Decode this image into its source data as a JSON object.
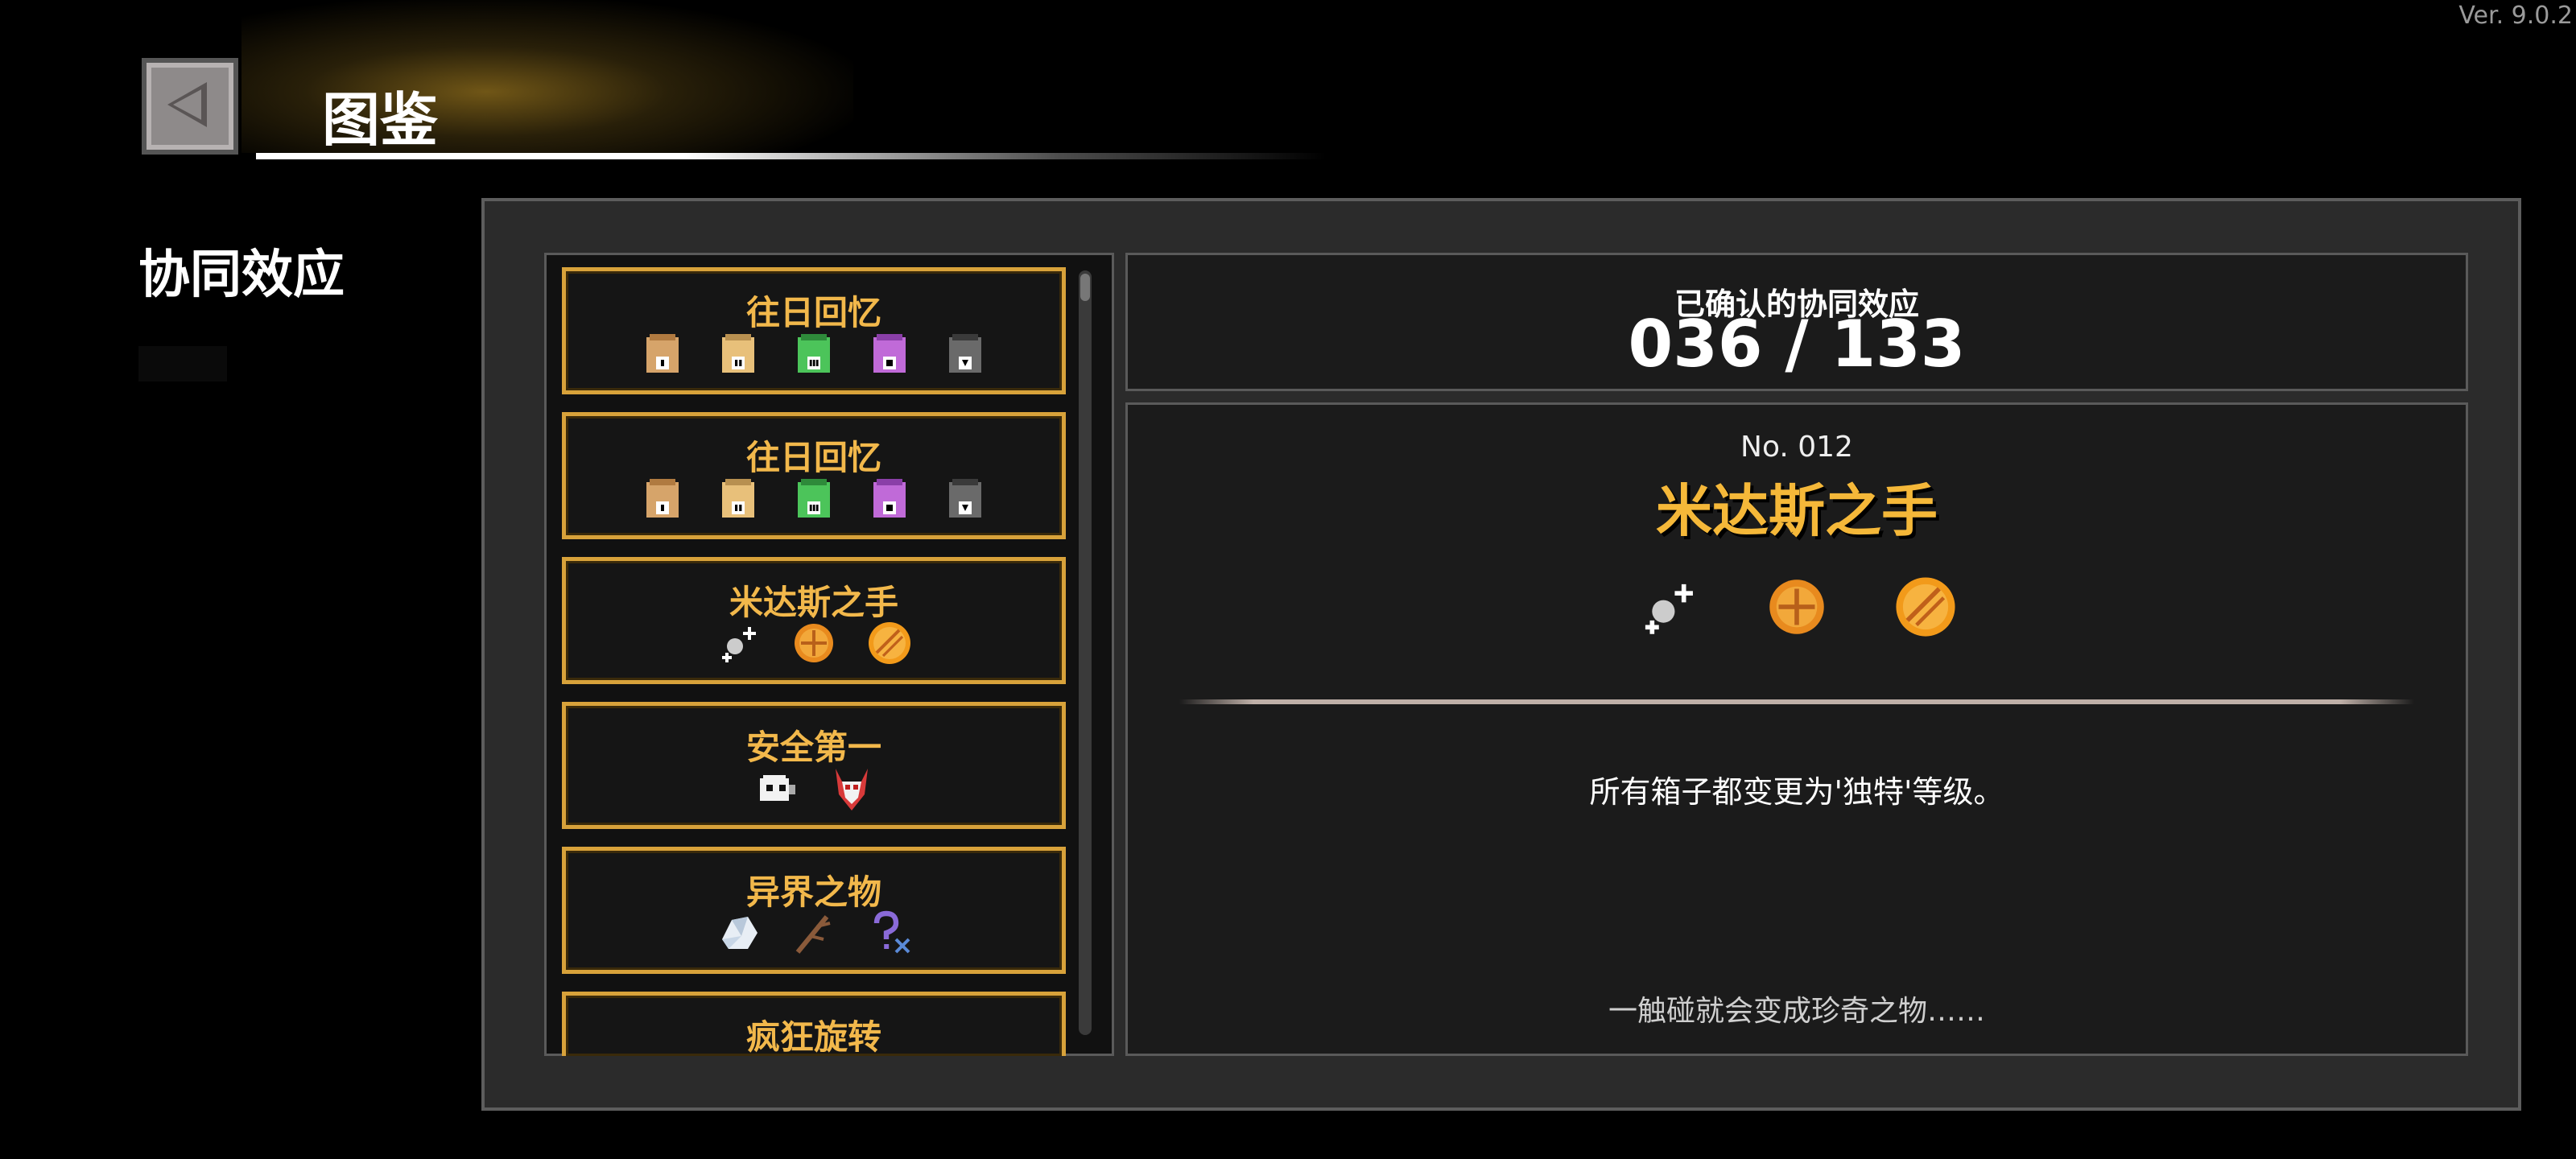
{
  "version": "Ver. 9.0.2",
  "header": {
    "title": "图鉴"
  },
  "section": {
    "title": "协同效应"
  },
  "synergy_list": [
    {
      "name": "往日回忆",
      "icons": [
        "tan-pouch-I-icon",
        "tan-pouch-II-icon",
        "green-pouch-III-icon",
        "purple-pouch-IV-icon",
        "grey-pouch-V-icon"
      ]
    },
    {
      "name": "往日回忆",
      "icons": [
        "tan-pouch-I-icon",
        "tan-pouch-II-icon",
        "green-pouch-III-icon",
        "purple-pouch-IV-icon",
        "grey-pouch-V-icon"
      ]
    },
    {
      "name": "米达斯之手",
      "icons": [
        "sparkle-bead-icon",
        "gold-coin-icon",
        "gold-disc-icon"
      ]
    },
    {
      "name": "安全第一",
      "icons": [
        "white-skull-icon",
        "red-demon-mask-icon"
      ]
    },
    {
      "name": "异界之物",
      "icons": [
        "crystal-rock-icon",
        "dead-branch-icon",
        "purple-question-icon"
      ]
    },
    {
      "name": "疯狂旋转",
      "icons": []
    }
  ],
  "counter": {
    "label": "已确认的协同效应",
    "value": "036 / 133"
  },
  "detail": {
    "number": "No. 012",
    "name": "米达斯之手",
    "icons": [
      "sparkle-bead-icon",
      "gold-coin-icon",
      "gold-disc-icon"
    ],
    "description": "所有箱子都变更为'独特'等级。",
    "flavor": "一触碰就会变成珍奇之物……"
  },
  "colors": {
    "accent_gold": "#f5b839",
    "item_border": "#d8a23a",
    "panel_bg": "#2b2b2b"
  }
}
